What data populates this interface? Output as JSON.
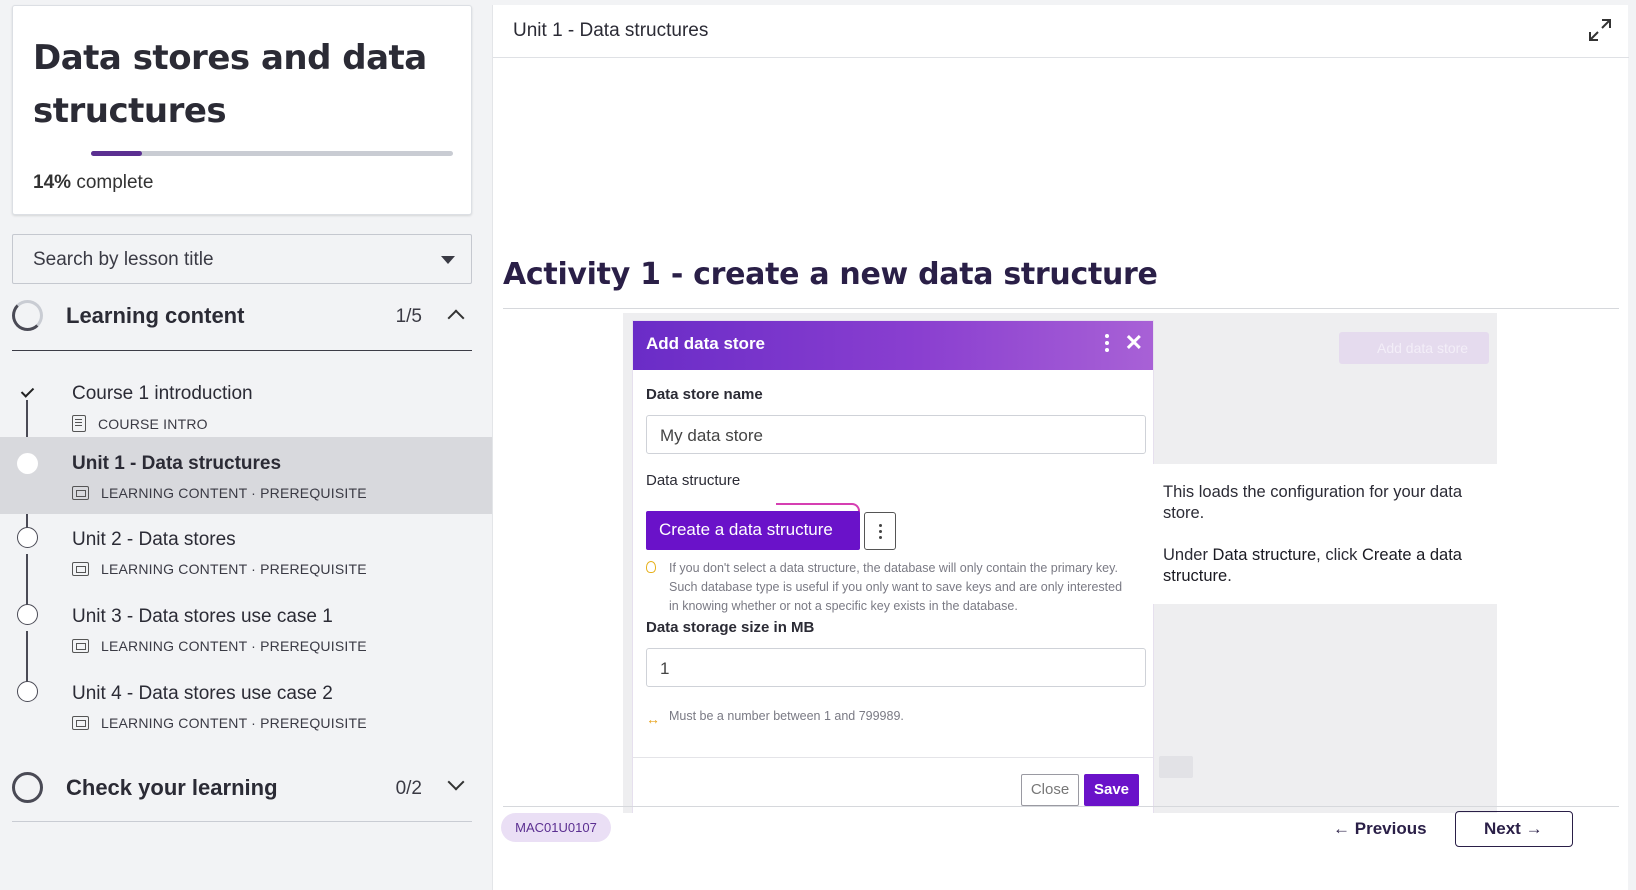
{
  "course": {
    "title": "Data stores and data structures",
    "progress_percent": "14%",
    "progress_fraction": 0.14,
    "progress_suffix": "complete"
  },
  "search": {
    "placeholder": "Search by lesson title"
  },
  "sections": [
    {
      "title": "Learning content",
      "count": "1/5",
      "expanded": true
    },
    {
      "title": "Check your learning",
      "count": "0/2",
      "expanded": false
    }
  ],
  "lessons": [
    {
      "name": "Course 1 introduction",
      "meta": "COURSE INTRO",
      "status": "complete"
    },
    {
      "name": "Unit 1 - Data structures",
      "meta": "LEARNING CONTENT · PREREQUISITE",
      "status": "active"
    },
    {
      "name": "Unit 2 - Data stores",
      "meta": "LEARNING CONTENT · PREREQUISITE",
      "status": "not-started"
    },
    {
      "name": "Unit 3 - Data stores use case 1",
      "meta": "LEARNING CONTENT · PREREQUISITE",
      "status": "not-started"
    },
    {
      "name": "Unit 4 - Data stores use case 2",
      "meta": "LEARNING CONTENT · PREREQUISITE",
      "status": "not-started"
    }
  ],
  "main": {
    "unit_title": "Unit 1 - Data structures",
    "activity_title": "Activity 1 - create a new data structure",
    "code": "MAC01U0107",
    "previous_label": "Previous",
    "next_label": "Next"
  },
  "screenshot": {
    "background_button": "Add data store",
    "dialog": {
      "title": "Add data store",
      "name_label": "Data store name",
      "name_value": "My data store",
      "structure_label": "Data structure",
      "create_button": "Create a data structure",
      "hint": "If you don't select a data structure, the database will only contain the primary key. Such database type is useful if you only want to save keys and are only interested in knowing whether or not a specific key exists in the database.",
      "size_label": "Data storage size in MB",
      "size_value": "1",
      "size_hint": "Must be a number between 1 and 799989.",
      "close_button": "Close",
      "save_button": "Save"
    },
    "callout": {
      "line1": "This loads the configuration for your data store.",
      "line2_prefix": "Under ",
      "line2_b1": "Data structure",
      "line2_mid": ", click ",
      "line2_b2": "Create a data structure",
      "line2_end": "."
    }
  },
  "colors": {
    "brand_purple": "#6a12c9",
    "heading": "#2a1f47",
    "active_row": "#d8d9dd"
  }
}
